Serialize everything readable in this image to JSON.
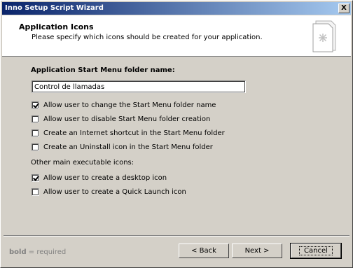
{
  "window": {
    "title": "Inno Setup Script Wizard",
    "close_glyph": "X"
  },
  "header": {
    "title": "Application Icons",
    "subtitle": "Please specify which icons should be created for your application.",
    "icon": "wizard-document-icon"
  },
  "form": {
    "folder_label": "Application Start Menu folder name:",
    "folder_value": "Control de llamadas",
    "checkboxes": [
      {
        "label": "Allow user to change the Start Menu folder name",
        "checked": true
      },
      {
        "label": "Allow user to disable Start Menu folder creation",
        "checked": false
      },
      {
        "label": "Create an Internet shortcut in the Start Menu folder",
        "checked": false
      },
      {
        "label": "Create an Uninstall icon in the Start Menu folder",
        "checked": false
      }
    ],
    "other_label": "Other main executable icons:",
    "other_checkboxes": [
      {
        "label": "Allow user to create a desktop icon",
        "checked": true
      },
      {
        "label": "Allow user to create a Quick Launch icon",
        "checked": false
      }
    ]
  },
  "footer": {
    "note_bold": "bold",
    "note_rest": " = required",
    "back_label": "< Back",
    "next_label": "Next >",
    "cancel_label": "Cancel"
  }
}
